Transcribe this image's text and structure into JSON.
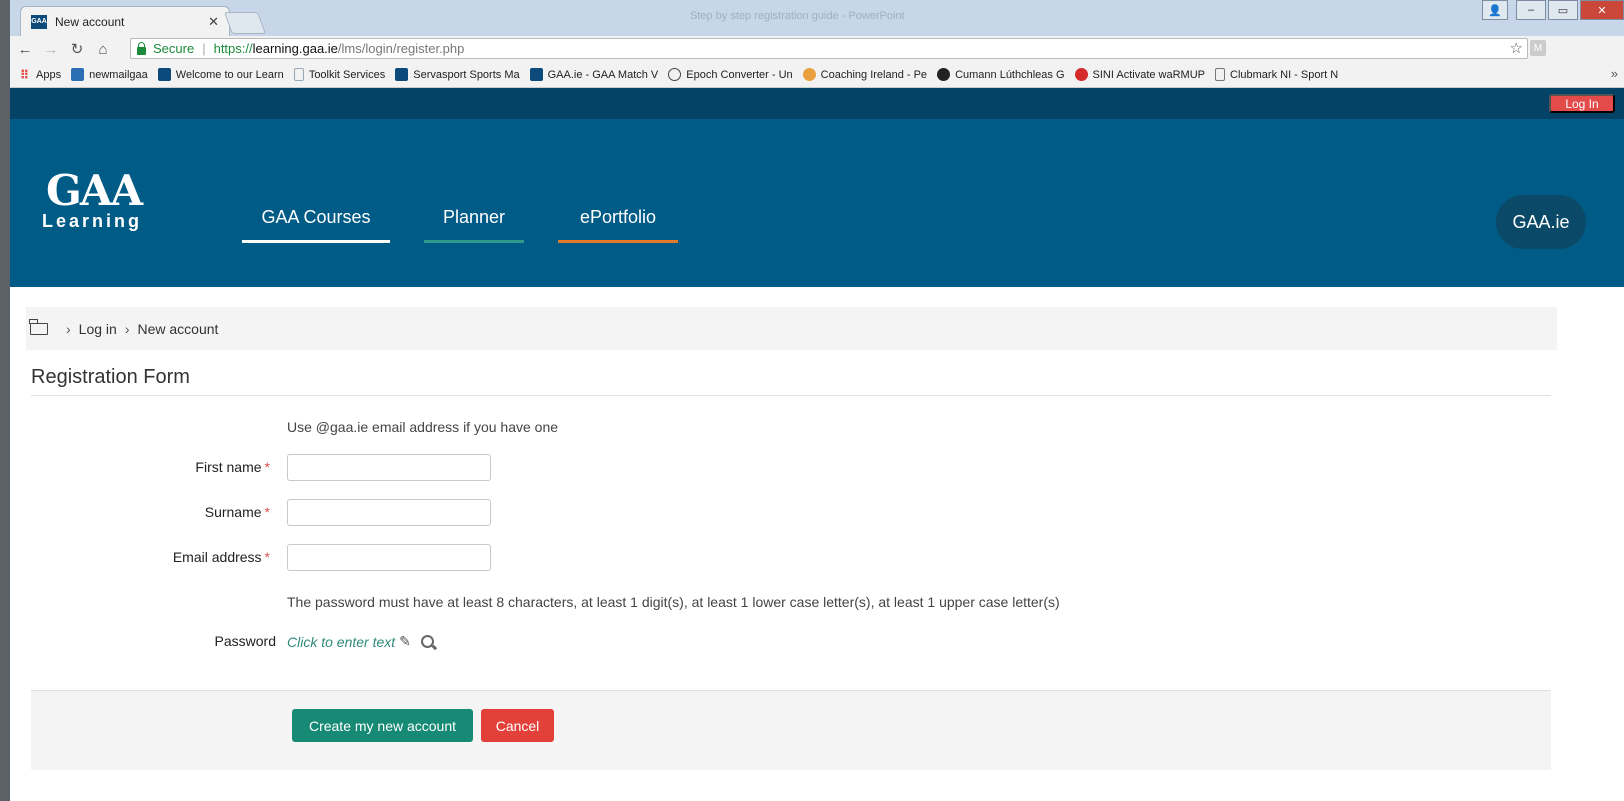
{
  "browser": {
    "tab_title": "New account",
    "tab_favicon_text": "GAA",
    "window_title": "Step by step registration guide - PowerPoint",
    "secure_label": "Secure",
    "url_scheme": "https://",
    "url_host": "learning.gaa.ie",
    "url_path": "/lms/login/register.php",
    "profile_initial": "M",
    "bookmarks": [
      {
        "label": "Apps",
        "icon": "apps-grid-icon",
        "color": "#e34a4a"
      },
      {
        "label": "newmailgaa",
        "icon": "calendar-icon",
        "color": "#2a6fb3"
      },
      {
        "label": "Welcome to our Learn",
        "icon": "gaa-favicon",
        "color": "#0b4a7a"
      },
      {
        "label": "Toolkit Services",
        "icon": "page-icon",
        "color": "#9aa8b6"
      },
      {
        "label": "Servasport Sports Ma",
        "icon": "gaa-favicon",
        "color": "#0b4a7a"
      },
      {
        "label": "GAA.ie - GAA Match V",
        "icon": "gaa-favicon",
        "color": "#0b4a7a"
      },
      {
        "label": "Epoch Converter - Un",
        "icon": "clock-icon",
        "color": "#444444"
      },
      {
        "label": "Coaching Ireland - Pe",
        "icon": "coaching-icon",
        "color": "#e8a040"
      },
      {
        "label": "Cumann Lúthchleas G",
        "icon": "gaa-crest-icon",
        "color": "#222222"
      },
      {
        "label": "SINI Activate waRMUP",
        "icon": "sini-icon",
        "color": "#d42a2a"
      },
      {
        "label": "Clubmark NI - Sport N",
        "icon": "page-icon",
        "color": "#777777"
      }
    ]
  },
  "site": {
    "login_label": "Log In",
    "logo_mark": "GAA",
    "logo_sub": "Learning",
    "nav": [
      {
        "label": "GAA Courses"
      },
      {
        "label": "Planner"
      },
      {
        "label": "ePortfolio"
      }
    ],
    "gaa_link": "GAA.ie"
  },
  "breadcrumb": {
    "items": [
      "Log in",
      "New account"
    ],
    "separator": "›"
  },
  "form": {
    "heading": "Registration Form",
    "email_note": "Use @gaa.ie email address if you have one",
    "fields": [
      {
        "label": "First name",
        "value": ""
      },
      {
        "label": "Surname",
        "value": ""
      },
      {
        "label": "Email address",
        "value": ""
      }
    ],
    "required_marker": "*",
    "password_rules": "The password must have at least 8 characters, at least 1 digit(s), at least 1 lower case letter(s), at least 1 upper case letter(s)",
    "password_label": "Password",
    "password_placeholder": "Click to enter text",
    "submit_label": "Create my new account",
    "cancel_label": "Cancel"
  },
  "colors": {
    "header_blue": "#005b86",
    "topbar_blue": "#044366",
    "primary_green": "#168a74",
    "danger_red": "#e3403a"
  }
}
